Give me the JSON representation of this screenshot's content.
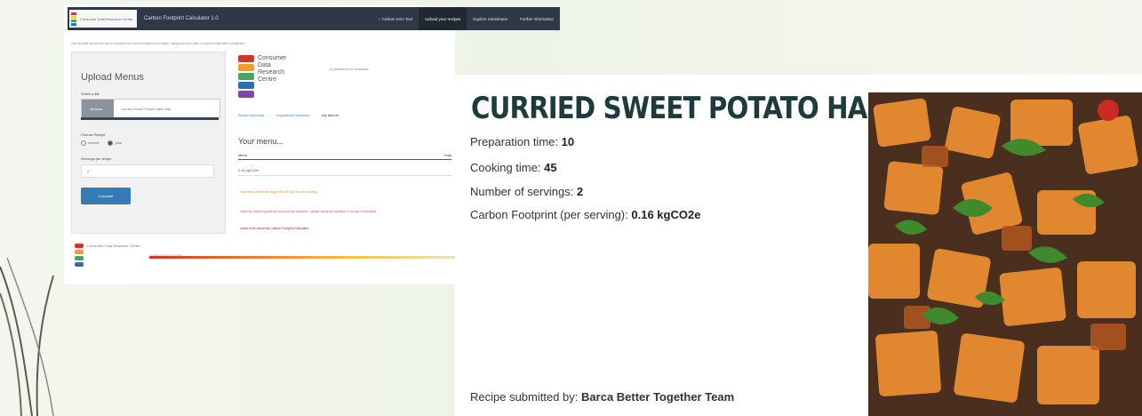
{
  "app": {
    "brand": {
      "logo_caption": "Consumer Data Research Centre",
      "title": "Carbon Footprint Calculator 1.0"
    },
    "nav": [
      {
        "label": "⌂ Carbon Intro Text",
        "active": false
      },
      {
        "label": "Upload your recipes",
        "active": true
      },
      {
        "label": "Explore Substitutes",
        "active": false
      },
      {
        "label": "Further information",
        "active": false
      }
    ],
    "intro_text": "Use the tabs across the top to complete the carbon footprint of a recipe, using your own data, or explore ingredient substitutes.",
    "sidebar": {
      "title": "Upload Menus",
      "select_file_label": "Select a file",
      "browse_label": "Browse...",
      "file_name": "Curried Sweet Potato Hash.xlsx",
      "choose_recipe_label": "Choose Recipe",
      "radio_options": [
        {
          "label": "current",
          "selected": false
        },
        {
          "label": "plan",
          "selected": true
        }
      ],
      "servings_label": "Servings per recipe",
      "servings_value": "2",
      "calculate_label": "Calculate"
    },
    "logo": {
      "line1": "Consumer",
      "line2": "Data",
      "line3": "Research",
      "line4": "Centre",
      "badge": "In partnership for accessible"
    },
    "tabs": [
      {
        "label": "Recipe Amounts",
        "active": false
      },
      {
        "label": "Ingredient Emissions",
        "active": false
      },
      {
        "label": "My Menus",
        "active": true
      }
    ],
    "menus": {
      "title": "Your menu...",
      "col_menu": "Menu",
      "col_total": "Total",
      "row_value": "0.16 kgCO2e"
    },
    "messages": {
      "orange": "This menu meets the target of 0.64 kgCO2e per serving",
      "red": "Warning: some ingredients could not be matched - please check the spelling or choose a substitute",
      "dark": "Learn more about the Carbon Footprint Calculator"
    },
    "footer": {
      "logo_caption": "Consumer Data Research Centre",
      "badge": "In partnership for accessible"
    }
  },
  "recipe": {
    "title": "CURRIED SWEET POTATO HASH",
    "prep_label": "Preparation time:",
    "prep_value": "10",
    "cook_label": "Cooking time:",
    "cook_value": "45",
    "servings_label": "Number of servings:",
    "servings_value": "2",
    "carbon_label": "Carbon Footprint (per serving):",
    "carbon_value": "0.16 kgCO2e",
    "submitted_label": "Recipe submitted by:",
    "submitted_value": "Barca Better Together Team"
  },
  "colors": {
    "nav_bg": "#2e3846",
    "button_blue": "#337ab7",
    "title_green": "#1e3b3c",
    "logo_stack": [
      "#d8332b",
      "#f59c2a",
      "#f6cf3b",
      "#4aa564",
      "#2a6fb4",
      "#7d4aa1"
    ]
  }
}
